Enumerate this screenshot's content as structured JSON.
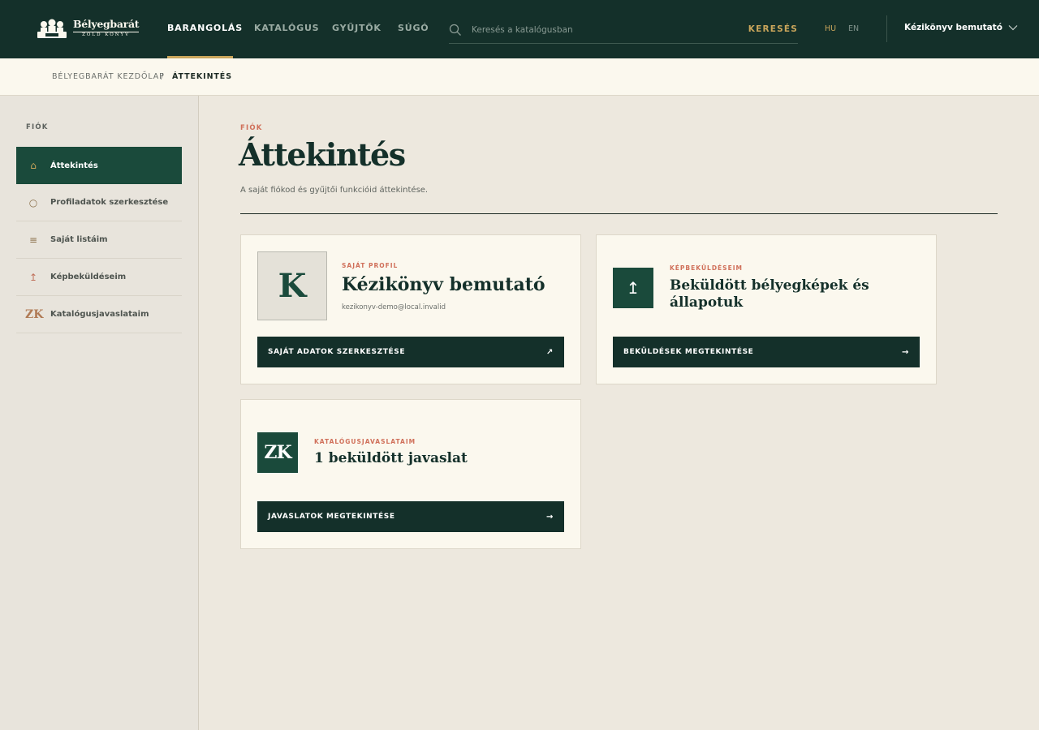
{
  "header": {
    "logo": {
      "title": "Bélyegbarát",
      "subtitle": "ZÖLD KÖNYV"
    },
    "nav": [
      {
        "label": "BARANGOLÁS",
        "active": true
      },
      {
        "label": "KATALÓGUS",
        "active": false
      },
      {
        "label": "GYŰJTŐK",
        "active": false
      },
      {
        "label": "SÚGÓ",
        "active": false
      }
    ],
    "search": {
      "placeholder": "Keresés a katalógusban",
      "value": "",
      "button_label": "KERESÉS"
    },
    "languages": [
      {
        "code": "HU",
        "active": true
      },
      {
        "code": "EN",
        "active": false
      }
    ],
    "user_menu_label": "Kézikönyv bemutató"
  },
  "breadcrumb": {
    "home": "BÉLYEGBARÁT KEZDŐLAP",
    "separator": "/",
    "current": "ÁTTEKINTÉS"
  },
  "sidebar": {
    "heading": "FIÓK",
    "items": [
      {
        "label": "Áttekintés",
        "icon": "home-icon",
        "glyph": "⌂",
        "active": true
      },
      {
        "label": "Profiladatok szerkesztése",
        "icon": "circle-icon",
        "glyph": "○",
        "active": false
      },
      {
        "label": "Saját listáim",
        "icon": "list-icon",
        "glyph": "≡",
        "active": false
      },
      {
        "label": "Képbeküldéseim",
        "icon": "upload-arrow-icon",
        "glyph": "↥",
        "active": false
      },
      {
        "label": "Katalógusjavaslataim",
        "icon": "zk-monogram-icon",
        "glyph": "ZK",
        "active": false
      }
    ]
  },
  "main": {
    "kicker": "FIÓK",
    "title": "Áttekintés",
    "subtitle": "A saját fiókod és gyűjtői funkcióid áttekintése.",
    "cards": {
      "profile": {
        "avatar_letter": "K",
        "kicker": "SAJÁT PROFIL",
        "title": "Kézikönyv bemutató",
        "email": "kezikonyv-demo@local.invalid",
        "button_label": "SAJÁT ADATOK SZERKESZTÉSE",
        "button_arrow": "↗"
      },
      "submissions": {
        "badge_glyph": "↥",
        "kicker": "KÉPBEKÜLDÉSEIM",
        "title_line1": "Beküldött bélyegképek és",
        "title_line2": "állapotuk",
        "button_label": "BEKÜLDÉSEK MEGTEKINTÉSE",
        "button_arrow": "→"
      },
      "suggestions": {
        "badge_glyph": "ZK",
        "kicker": "KATALÓGUSJAVASLATAIM",
        "title": "1 beküldött javaslat",
        "button_label": "JAVASLATOK MEGTEKINTÉSE",
        "button_arrow": "→"
      }
    }
  },
  "colors": {
    "header_bg": "#14302a",
    "accent_gold": "#c9a55b",
    "accent_coral": "#d0705a",
    "active_green": "#1a4a3b",
    "paper": "#fbf8ee"
  }
}
